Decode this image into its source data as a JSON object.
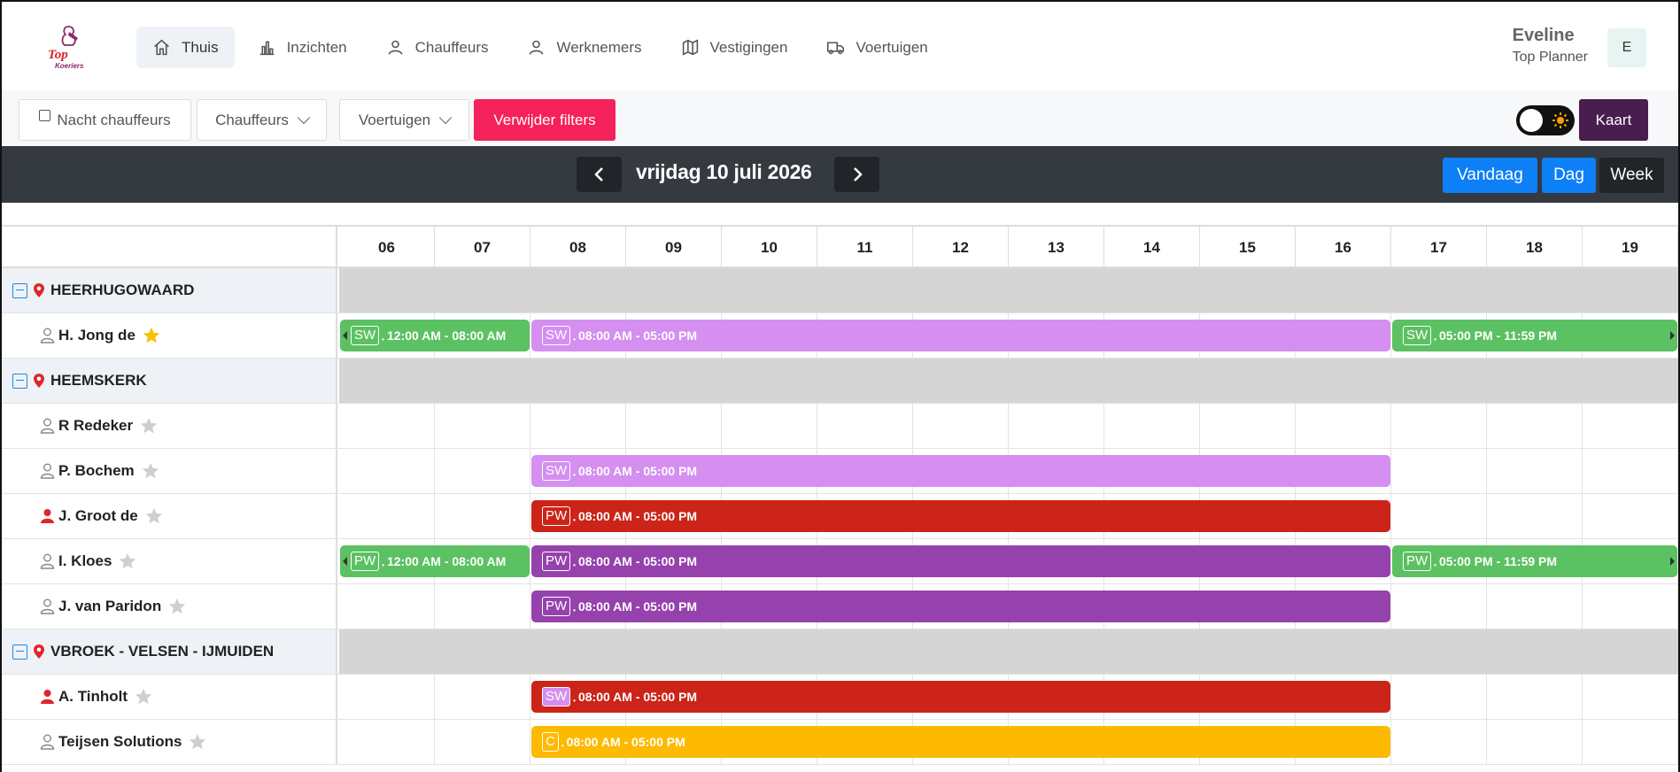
{
  "brand": {
    "logo_text_top": "Top",
    "logo_text_bottom": "Koeriers"
  },
  "nav": [
    {
      "label": "Thuis",
      "icon": "home-icon",
      "active": true
    },
    {
      "label": "Inzichten",
      "icon": "bar-chart-icon",
      "active": false
    },
    {
      "label": "Chauffeurs",
      "icon": "user-icon",
      "active": false
    },
    {
      "label": "Werknemers",
      "icon": "user-icon",
      "active": false
    },
    {
      "label": "Vestigingen",
      "icon": "map-icon",
      "active": false
    },
    {
      "label": "Voertuigen",
      "icon": "truck-icon",
      "active": false
    }
  ],
  "user": {
    "name": "Eveline",
    "role": "Top Planner",
    "initial": "E"
  },
  "filters": {
    "night_drivers": "Nacht chauffeurs",
    "drivers": "Chauffeurs",
    "vehicles": "Voertuigen",
    "clear": "Verwijder filters",
    "map": "Kaart"
  },
  "datebar": {
    "date": "vrijdag 10 juli 2026",
    "today": "Vandaag",
    "day": "Dag",
    "week": "Week"
  },
  "hours": [
    "06",
    "07",
    "08",
    "09",
    "10",
    "11",
    "12",
    "13",
    "14",
    "15",
    "16",
    "17",
    "18",
    "19"
  ],
  "colors": {
    "green": "#5cc162",
    "lilac": "#d48ff0",
    "red": "#cc2418",
    "purple": "#9642ad",
    "yellow": "#fdba00",
    "blue": "#0d7ff7",
    "dark": "#212529"
  },
  "rows": [
    {
      "type": "group",
      "label": "HEERHUGOWAARD"
    },
    {
      "type": "person",
      "label": "H. Jong de",
      "filled_user": false,
      "starred": true,
      "shifts": [
        {
          "tag": "SW",
          "time": "12:00 AM - 08:00 AM",
          "color": "green",
          "start": 6,
          "end": 8,
          "left_arrow": true
        },
        {
          "tag": "SW",
          "time": "08:00 AM - 05:00 PM",
          "color": "lilac",
          "start": 8,
          "end": 17
        },
        {
          "tag": "SW",
          "time": "05:00 PM - 11:59 PM",
          "color": "green",
          "start": 17,
          "end": 20,
          "right_arrow": true
        }
      ]
    },
    {
      "type": "group",
      "label": "HEEMSKERK"
    },
    {
      "type": "person",
      "label": "R Redeker",
      "filled_user": false,
      "starred": false,
      "shifts": []
    },
    {
      "type": "person",
      "label": "P. Bochem",
      "filled_user": false,
      "starred": false,
      "shifts": [
        {
          "tag": "SW",
          "time": "08:00 AM - 05:00 PM",
          "color": "lilac",
          "start": 8,
          "end": 17
        }
      ]
    },
    {
      "type": "person",
      "label": "J. Groot de",
      "filled_user": true,
      "starred": false,
      "shifts": [
        {
          "tag": "PW",
          "time": "08:00 AM - 05:00 PM",
          "color": "red",
          "start": 8,
          "end": 17
        }
      ]
    },
    {
      "type": "person",
      "label": "I. Kloes",
      "filled_user": false,
      "starred": false,
      "shifts": [
        {
          "tag": "PW",
          "time": "12:00 AM - 08:00 AM",
          "color": "green",
          "start": 6,
          "end": 8,
          "left_arrow": true
        },
        {
          "tag": "PW",
          "time": "08:00 AM - 05:00 PM",
          "color": "purple",
          "start": 8,
          "end": 17
        },
        {
          "tag": "PW",
          "time": "05:00 PM - 11:59 PM",
          "color": "green",
          "start": 17,
          "end": 20,
          "right_arrow": true
        }
      ]
    },
    {
      "type": "person",
      "label": "J. van Paridon",
      "filled_user": false,
      "starred": false,
      "shifts": [
        {
          "tag": "PW",
          "time": "08:00 AM - 05:00 PM",
          "color": "purple",
          "start": 8,
          "end": 17
        }
      ]
    },
    {
      "type": "group",
      "label": "VBROEK - VELSEN - IJMUIDEN"
    },
    {
      "type": "person",
      "label": "A. Tinholt",
      "filled_user": true,
      "starred": false,
      "shifts": [
        {
          "tag": "SW",
          "time": "08:00 AM - 05:00 PM",
          "color": "red",
          "start": 8,
          "end": 17,
          "tag_bg": "#d48ff0"
        }
      ]
    },
    {
      "type": "person",
      "label": "Teijsen Solutions",
      "filled_user": false,
      "starred": false,
      "shifts": [
        {
          "tag": "C",
          "time": "08:00 AM - 05:00 PM",
          "color": "yellow",
          "start": 8,
          "end": 17
        }
      ]
    }
  ]
}
